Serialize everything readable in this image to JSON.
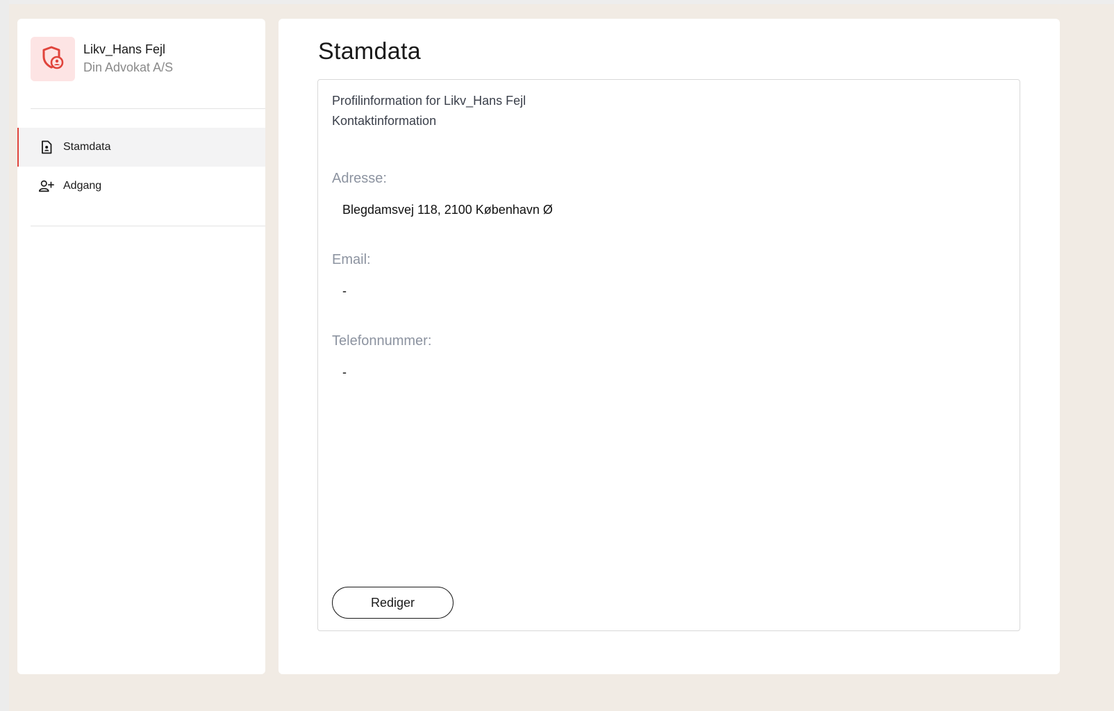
{
  "profile": {
    "name": "Likv_Hans Fejl",
    "company": "Din Advokat A/S",
    "avatar_icon": "shield-user-icon",
    "avatar_color": "#e0443c",
    "avatar_bg": "#fde4e4"
  },
  "sidebar": {
    "items": [
      {
        "label": "Stamdata",
        "icon": "file-user-icon",
        "active": true
      },
      {
        "label": "Adgang",
        "icon": "user-plus-icon",
        "active": false
      }
    ],
    "active_color": "#e0443c"
  },
  "main": {
    "title": "Stamdata",
    "card": {
      "profile_line": "Profilinformation for Likv_Hans Fejl",
      "section_line": "Kontaktinformation",
      "fields": {
        "address_label": "Adresse:",
        "address_value": "Blegdamsvej 118, 2100 København Ø",
        "email_label": "Email:",
        "email_value": "-",
        "phone_label": "Telefonnummer:",
        "phone_value": "-"
      },
      "edit_label": "Rediger"
    }
  }
}
